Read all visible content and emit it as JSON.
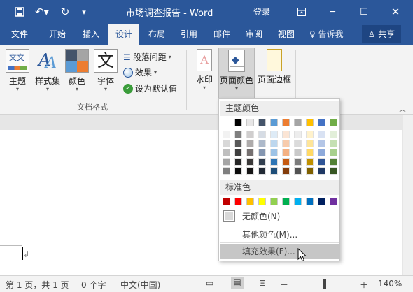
{
  "title_bar": {
    "doc_title": "市场调查报告 - Word",
    "login": "登录",
    "quick_access": [
      "save-icon",
      "undo-icon",
      "redo-icon",
      "customize-icon"
    ]
  },
  "tabs": [
    {
      "label": "文件"
    },
    {
      "label": "开始"
    },
    {
      "label": "插入"
    },
    {
      "label": "设计"
    },
    {
      "label": "布局"
    },
    {
      "label": "引用"
    },
    {
      "label": "邮件"
    },
    {
      "label": "审阅"
    },
    {
      "label": "视图"
    }
  ],
  "tell_me": "♀ 告诉我",
  "share": "共享",
  "ribbon": {
    "theme": "主题",
    "style_set": "样式集",
    "colors": "颜色",
    "fonts": "字体",
    "para_spacing": "段落间距",
    "effects": "效果",
    "set_default": "设为默认值",
    "group_doc_format": "文档格式",
    "watermark": "水印",
    "page_color": "页面颜色",
    "page_border": "页面边框"
  },
  "menu": {
    "theme_colors_header": "主题颜色",
    "standard_header": "标准色",
    "no_color": "无颜色(N)",
    "more_colors": "其他颜色(M)...",
    "fill_effects": "填充效果(F)...",
    "theme_top": [
      "#ffffff",
      "#000000",
      "#e7e6e6",
      "#44546a",
      "#5b9bd5",
      "#ed7d31",
      "#a5a5a5",
      "#ffc000",
      "#4472c4",
      "#70ad47"
    ],
    "theme_shades": [
      [
        "#f2f2f2",
        "#7f7f7f",
        "#d0cece",
        "#d6dce4",
        "#deebf6",
        "#fbe5d5",
        "#ededed",
        "#fff2cc",
        "#d9e2f3",
        "#e2efd9"
      ],
      [
        "#d8d8d8",
        "#595959",
        "#aeabab",
        "#adb9ca",
        "#bdd7ee",
        "#f7cbac",
        "#dbdbdb",
        "#fee599",
        "#b4c6e7",
        "#c5e0b3"
      ],
      [
        "#bfbfbf",
        "#3f3f3f",
        "#757070",
        "#8496b0",
        "#9dc3e6",
        "#f4b183",
        "#c9c9c9",
        "#ffd965",
        "#8eaadb",
        "#a8d08d"
      ],
      [
        "#a5a5a5",
        "#262626",
        "#3a3838",
        "#323f4f",
        "#2e75b5",
        "#c55a11",
        "#7b7b7b",
        "#bf9000",
        "#2f5496",
        "#538135"
      ],
      [
        "#7f7f7f",
        "#0c0c0c",
        "#171616",
        "#222a35",
        "#1e4e79",
        "#833c0b",
        "#525252",
        "#7f6000",
        "#1f3864",
        "#375623"
      ]
    ],
    "standard": [
      "#c00000",
      "#ff0000",
      "#ffc000",
      "#ffff00",
      "#92d050",
      "#00b050",
      "#00b0f0",
      "#0070c0",
      "#002060",
      "#7030a0"
    ]
  },
  "status": {
    "page": "第 1 页，共 1 页",
    "words": "0 个字",
    "lang": "中文(中国)",
    "zoom": "140%",
    "zoom_minus": "－",
    "zoom_plus": "＋"
  }
}
